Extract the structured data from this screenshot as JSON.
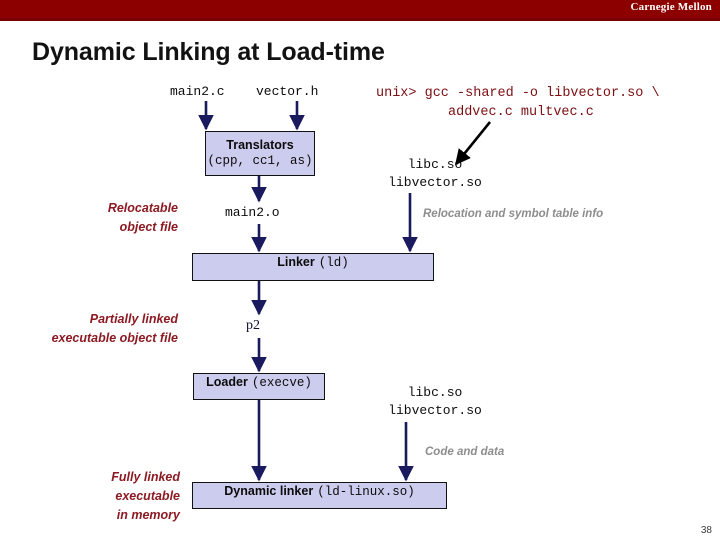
{
  "banner": {
    "institution": "Carnegie Mellon",
    "bg_color": "#8c0000"
  },
  "slide": {
    "title": "Dynamic Linking at Load-time",
    "page_number": "38"
  },
  "sources": {
    "main_source": "main2.c",
    "header_source": "vector.h"
  },
  "shell": {
    "command_line1": "unix> gcc -shared -o libvector.so \\",
    "command_line2": "addvec.c multvec.c",
    "color": "#7b0f12"
  },
  "boxes": {
    "translators": {
      "title": "Translators",
      "subtitle": "(cpp, cc1, as)",
      "fill": "#ccccee"
    },
    "linker": {
      "title": "Linker",
      "subtitle": "(ld)",
      "fill": "#ccccee"
    },
    "loader": {
      "title": "Loader",
      "subtitle": "(execve)",
      "fill": "#ccccee"
    },
    "dynamic_linker": {
      "title": "Dynamic linker",
      "subtitle": "(ld-linux.so)",
      "fill": "#ccccee"
    }
  },
  "artifacts": {
    "object_file": "main2.o",
    "partially_linked": "p2"
  },
  "libraries": {
    "upper": "libc.so\nlibvector.so",
    "lower": "libc.so\nlibvector.so"
  },
  "stage_labels": {
    "relocatable": "Relocatable\nobject file",
    "partially_linked": "Partially linked\nexecutable object file",
    "fully_linked": "Fully linked\nexecutable\nin memory",
    "color": "#8c1a22"
  },
  "annotations": {
    "relocation_info": "Relocation and symbol  table\ninfo",
    "code_and_data": "Code and data",
    "color": "#8d8d8d"
  }
}
